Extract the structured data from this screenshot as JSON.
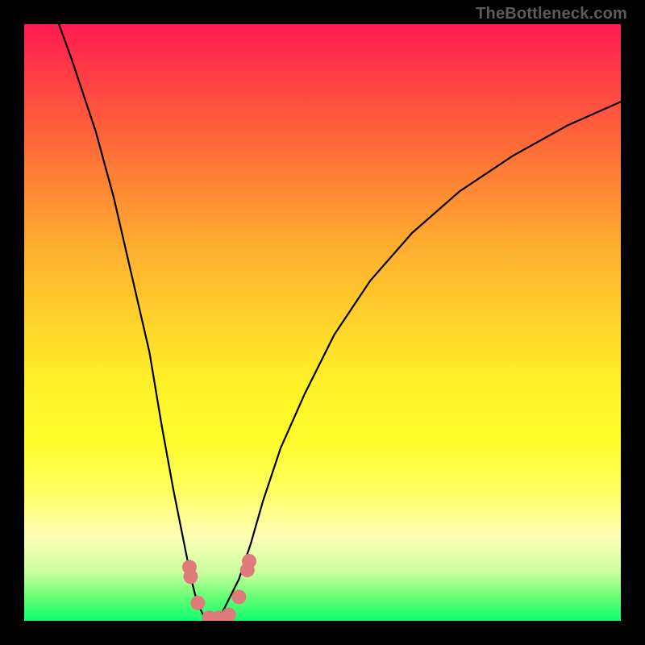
{
  "watermark": "TheBottleneck.com",
  "chart_data": {
    "type": "line",
    "title": "",
    "xlabel": "",
    "ylabel": "",
    "xlim": [
      0,
      100
    ],
    "ylim": [
      0,
      100
    ],
    "grid": false,
    "series": [
      {
        "name": "bottleneck-curve",
        "x": [
          0,
          4,
          8,
          12,
          15,
          18,
          21,
          23,
          25,
          27,
          28,
          29,
          30,
          31,
          32,
          33,
          34,
          36,
          38,
          40,
          43,
          47,
          52,
          58,
          65,
          73,
          82,
          91,
          100
        ],
        "values": [
          115,
          105,
          94,
          82,
          71,
          58,
          45,
          33,
          22,
          12,
          7,
          3,
          1,
          0,
          0,
          1,
          3,
          7,
          13,
          20,
          29,
          38,
          48,
          57,
          65,
          72,
          78,
          83,
          87
        ]
      }
    ],
    "markers": [
      {
        "name": "marker-left-upper",
        "x": 27.7,
        "y": 9.0
      },
      {
        "name": "marker-left-upper2",
        "x": 27.9,
        "y": 7.4
      },
      {
        "name": "marker-left-lower",
        "x": 29.1,
        "y": 3.0
      },
      {
        "name": "marker-trough-1",
        "x": 31.0,
        "y": 0.5
      },
      {
        "name": "marker-trough-2",
        "x": 32.6,
        "y": 0.5
      },
      {
        "name": "marker-trough-3",
        "x": 34.3,
        "y": 1.0
      },
      {
        "name": "marker-right-lower",
        "x": 36.0,
        "y": 4.0
      },
      {
        "name": "marker-right-upper",
        "x": 37.4,
        "y": 8.5
      },
      {
        "name": "marker-right-upper2",
        "x": 37.7,
        "y": 10.0
      }
    ],
    "marker_color": "#e07b7b",
    "marker_radius": 9
  }
}
